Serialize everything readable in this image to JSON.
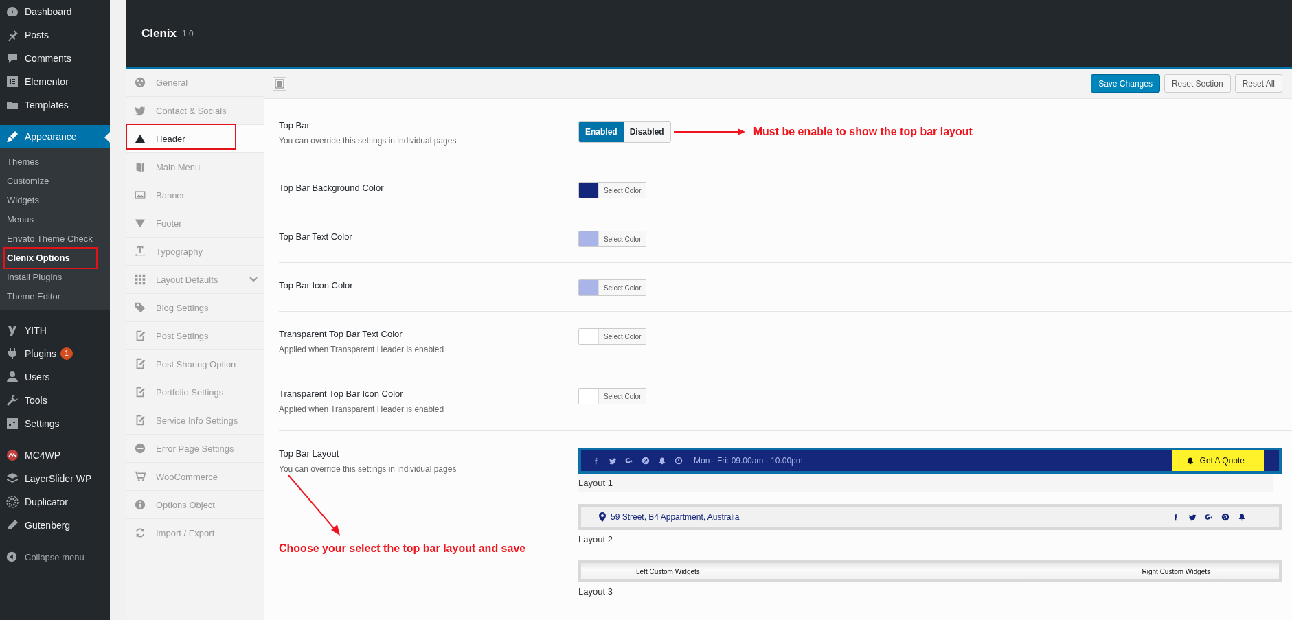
{
  "admin_menu": {
    "groups": [
      [
        {
          "label": "Dashboard",
          "selected": false
        },
        {
          "label": "Posts",
          "selected": false
        },
        {
          "label": "Comments",
          "selected": false
        },
        {
          "label": "Elementor",
          "selected": false
        },
        {
          "label": "Templates",
          "selected": false
        }
      ],
      [
        {
          "label": "Appearance",
          "selected": true,
          "submenu": [
            {
              "label": "Themes",
              "selected": false,
              "highlighted": false
            },
            {
              "label": "Customize",
              "selected": false,
              "highlighted": false
            },
            {
              "label": "Widgets",
              "selected": false,
              "highlighted": false
            },
            {
              "label": "Menus",
              "selected": false,
              "highlighted": false
            },
            {
              "label": "Envato Theme Check",
              "selected": false,
              "highlighted": false
            },
            {
              "label": "Clenix Options",
              "selected": true,
              "highlighted": true
            },
            {
              "label": "Install Plugins",
              "selected": false,
              "highlighted": false
            },
            {
              "label": "Theme Editor",
              "selected": false,
              "highlighted": false
            }
          ]
        }
      ],
      [
        {
          "label": "YITH",
          "selected": false
        },
        {
          "label": "Plugins",
          "selected": false,
          "badge": "1"
        },
        {
          "label": "Users",
          "selected": false
        },
        {
          "label": "Tools",
          "selected": false
        },
        {
          "label": "Settings",
          "selected": false
        }
      ],
      [
        {
          "label": "MC4WP",
          "selected": false
        },
        {
          "label": "LayerSlider WP",
          "selected": false
        },
        {
          "label": "Duplicator",
          "selected": false
        },
        {
          "label": "Gutenberg",
          "selected": false
        }
      ]
    ],
    "collapse_label": "Collapse menu"
  },
  "panel": {
    "title": "Clenix",
    "version": "1.0"
  },
  "options_nav": [
    {
      "label": "General",
      "kind": "page",
      "selected": false,
      "highlighted": false
    },
    {
      "label": "Contact & Socials",
      "kind": "page",
      "selected": false,
      "highlighted": false
    },
    {
      "label": "Header",
      "kind": "page",
      "selected": true,
      "highlighted": true
    },
    {
      "label": "Main Menu",
      "kind": "page",
      "selected": false,
      "highlighted": false
    },
    {
      "label": "Banner",
      "kind": "page",
      "selected": false,
      "highlighted": false
    },
    {
      "label": "Footer",
      "kind": "page",
      "selected": false,
      "highlighted": false
    },
    {
      "label": "Typography",
      "kind": "page",
      "selected": false,
      "highlighted": false
    },
    {
      "label": "Layout Defaults",
      "kind": "group",
      "selected": false,
      "highlighted": false
    },
    {
      "label": "Blog Settings",
      "kind": "page",
      "selected": false,
      "highlighted": false
    },
    {
      "label": "Post Settings",
      "kind": "page",
      "selected": false,
      "highlighted": false
    },
    {
      "label": "Post Sharing Option",
      "kind": "page",
      "selected": false,
      "highlighted": false
    },
    {
      "label": "Portfolio Settings",
      "kind": "page",
      "selected": false,
      "highlighted": false
    },
    {
      "label": "Service Info Settings",
      "kind": "page",
      "selected": false,
      "highlighted": false
    },
    {
      "label": "Error Page Settings",
      "kind": "page",
      "selected": false,
      "highlighted": false
    },
    {
      "label": "WooCommerce",
      "kind": "page",
      "selected": false,
      "highlighted": false
    },
    {
      "label": "Options Object",
      "kind": "page",
      "selected": false,
      "highlighted": false
    },
    {
      "label": "Import / Export",
      "kind": "page",
      "selected": false,
      "highlighted": false
    }
  ],
  "toolbar": {
    "buttons": [
      {
        "label": "Save Changes",
        "kind": "primary"
      },
      {
        "label": "Reset Section",
        "kind": "secondary"
      },
      {
        "label": "Reset All",
        "kind": "secondary"
      }
    ]
  },
  "settings": [
    {
      "kind": "toggle",
      "title": "Top Bar",
      "description": "You can override this settings in individual pages",
      "options": [
        {
          "label": "Enabled",
          "selected": true
        },
        {
          "label": "Disabled",
          "selected": false
        }
      ],
      "note": {
        "text": "Must be enable to show the top bar layout",
        "kind": "inline"
      }
    },
    {
      "kind": "color",
      "title": "Top Bar Background Color",
      "color": "#14277a",
      "button": "Select Color"
    },
    {
      "kind": "color",
      "title": "Top Bar Text Color",
      "color": "#a9b4e8",
      "button": "Select Color"
    },
    {
      "kind": "color",
      "title": "Top Bar Icon Color",
      "color": "#a9b4e8",
      "button": "Select Color"
    },
    {
      "kind": "color",
      "title": "Transparent Top Bar Text Color",
      "description": "Applied when Transparent Header is enabled",
      "color": "#ffffff",
      "button": "Select Color"
    },
    {
      "kind": "color",
      "title": "Transparent Top Bar Icon Color",
      "description": "Applied when Transparent Header is enabled",
      "color": "#ffffff",
      "button": "Select Color"
    },
    {
      "kind": "layouts",
      "title": "Top Bar Layout",
      "description": "You can override this settings in individual pages",
      "note": {
        "text": "Choose your select the top bar layout and save",
        "kind": "below"
      },
      "layouts": [
        {
          "kind": "schedule",
          "label": "Layout 1",
          "selected": true,
          "hours": "Mon - Fri: 09.00am - 10.00pm",
          "button": "Get A Quote"
        },
        {
          "kind": "address",
          "label": "Layout 2",
          "selected": false,
          "address": "59 Street, B4 Appartment, Australia"
        },
        {
          "kind": "widgets",
          "label": "Layout 3",
          "selected": false,
          "left": "Left Custom Widgets",
          "right": "Right Custom Widgets"
        }
      ]
    }
  ]
}
